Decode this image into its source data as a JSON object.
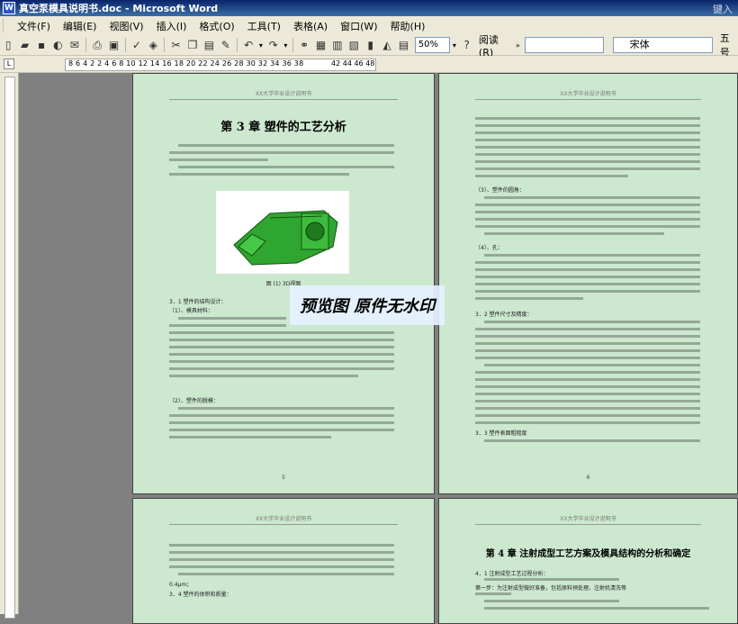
{
  "window": {
    "title": "真空泵模具说明书.doc - Microsoft Word",
    "help_prompt": "键入"
  },
  "menu": [
    "文件(F)",
    "编辑(E)",
    "视图(V)",
    "插入(I)",
    "格式(O)",
    "工具(T)",
    "表格(A)",
    "窗口(W)",
    "帮助(H)"
  ],
  "toolbar": {
    "zoom": "50%",
    "read_label": "阅读(R)",
    "font": "宋体",
    "size": "五号"
  },
  "ruler": {
    "left_numbers": "8 6 4 2 2 4 6 8 10 12 14 16 18 20 22 24 26 28 30 32 34 36 38",
    "right_numbers": "42 44 46 48"
  },
  "pages": {
    "header_text": "XX大学毕业设计说明书",
    "p1": {
      "chapter": "第 3 章  塑件的工艺分析",
      "figure_caption": "图 (1) 3D视图",
      "sec_311": "3．1  塑件的结构设计：",
      "sec_1": "（1）、模具材料：",
      "sec_2": "（2）、塑件的脱模：",
      "page_no": "5"
    },
    "p2": {
      "sec_3": "（3）、塑件的圆角：",
      "sec_4": "（4）、孔：",
      "sec_32": "3．2  塑件尺寸及精度：",
      "sec_33": "3．3  塑件表面粗糙度",
      "page_no": "6"
    },
    "p3": {
      "sec_34": "3．4  塑件的体积和质量：",
      "line1": "0.4μm；"
    },
    "p4": {
      "chapter": "第 4 章  注射成型工艺方案及模具结构的分析和确定",
      "sec_41": "4．1  注射成型工艺过程分析：",
      "line1": "第一步：为注射成型做好准备，包括原料预处理、注射机清洗等"
    }
  },
  "watermark": "预览图 原件无水印"
}
